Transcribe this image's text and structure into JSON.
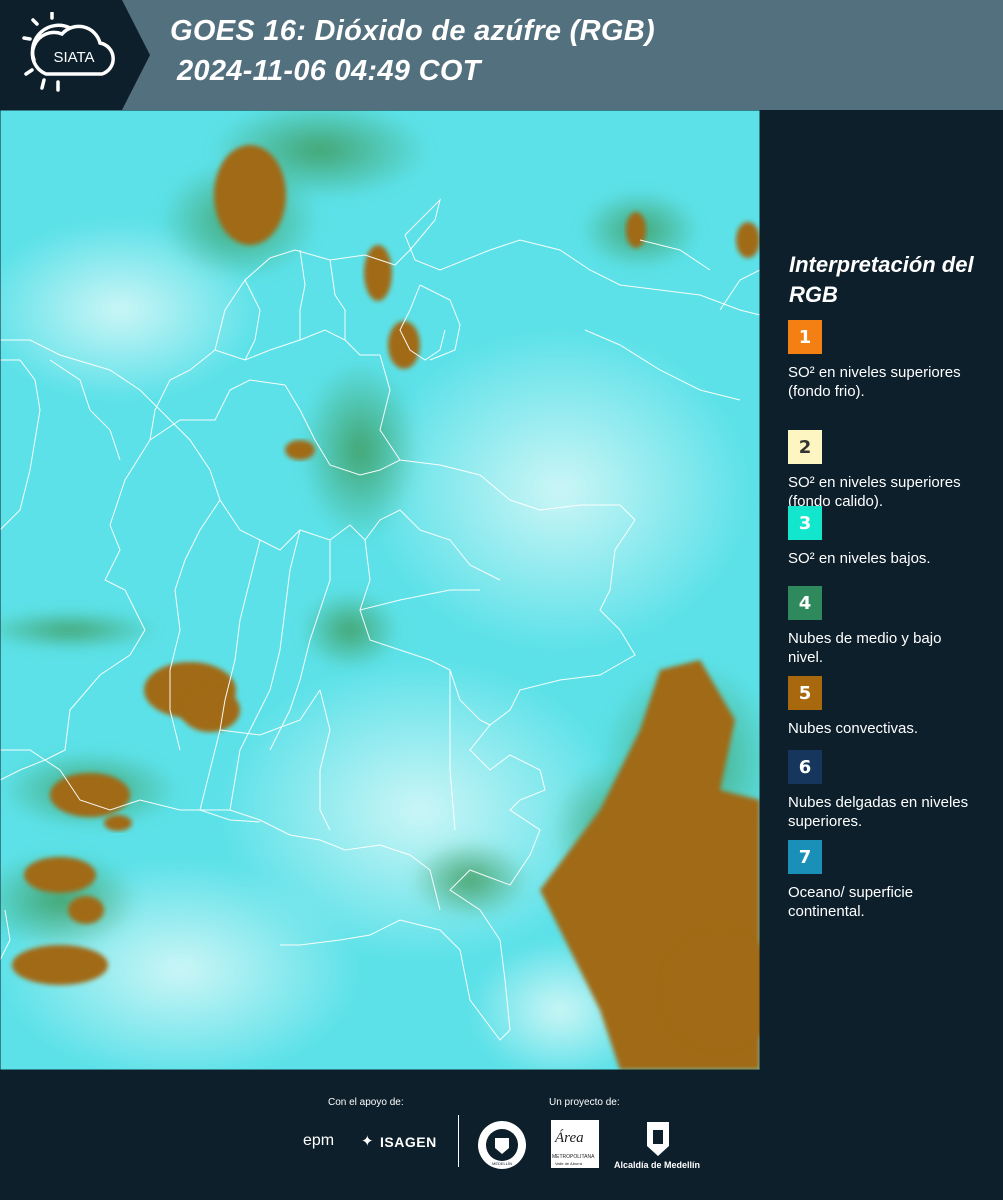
{
  "header": {
    "logo_text": "SIATA",
    "title_line1": "GOES 16: Dióxido de azúfre (RGB)",
    "title_line2": "2024-11-06 04:49 COT"
  },
  "legend": {
    "title": "Interpretación del RGB",
    "items": [
      {
        "number": "1",
        "color": "#f47f12",
        "label": "SO² en niveles superiores (fondo frio)."
      },
      {
        "number": "2",
        "color": "#fdf6c2",
        "label": "SO² en niveles superiores (fondo calido)."
      },
      {
        "number": "3",
        "color": "#12e6cd",
        "label": "SO² en niveles bajos."
      },
      {
        "number": "4",
        "color": "#2e8a5c",
        "label": "Nubes de medio y bajo nivel."
      },
      {
        "number": "5",
        "color": "#a8680e",
        "label": "Nubes convectivas."
      },
      {
        "number": "6",
        "color": "#17365e",
        "label": "Nubes delgadas en niveles superiores."
      },
      {
        "number": "7",
        "color": "#1a8fb8",
        "label": "Oceano/ superficie continental."
      }
    ]
  },
  "footer": {
    "support_label": "Con el apoyo de:",
    "project_label": "Un proyecto de:",
    "sponsor1": "epm",
    "sponsor2": "ISAGEN",
    "partner_area_name": "Área",
    "partner_area_sub": "METROPOLITANA",
    "partner_area_sub2": "Valle de Aburrá",
    "partner_alcaldia": "Alcaldía de Medellín",
    "partner_medellin_ring": "MEDELLÍN"
  }
}
